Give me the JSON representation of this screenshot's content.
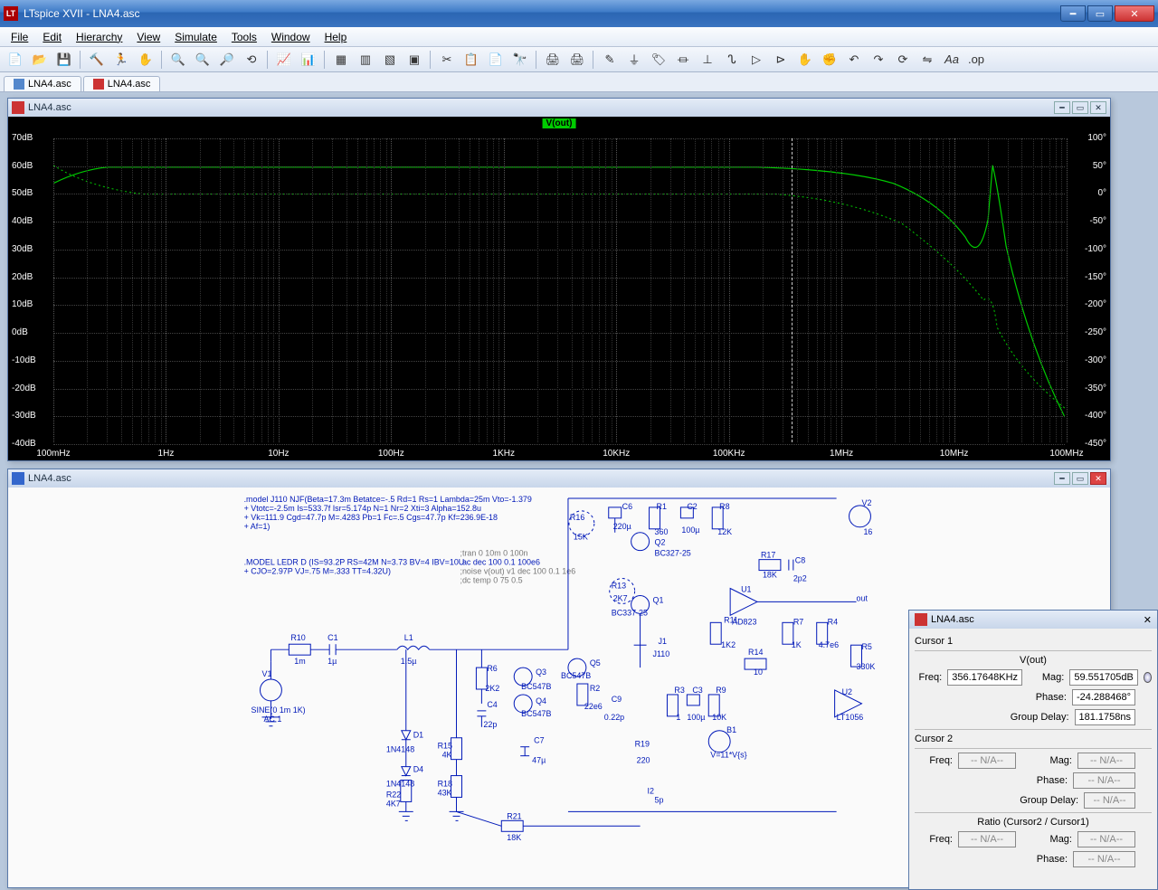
{
  "window": {
    "title": "LTspice XVII - LNA4.asc"
  },
  "menus": [
    "File",
    "Edit",
    "Hierarchy",
    "View",
    "Simulate",
    "Tools",
    "Window",
    "Help"
  ],
  "tabs": [
    {
      "icon": "sch",
      "label": "LNA4.asc"
    },
    {
      "icon": "plt",
      "label": "LNA4.asc"
    }
  ],
  "plot": {
    "title": "LNA4.asc",
    "trace_label": "V(out)",
    "y_left": [
      "70dB",
      "60dB",
      "50dB",
      "40dB",
      "30dB",
      "20dB",
      "10dB",
      "0dB",
      "-10dB",
      "-20dB",
      "-30dB",
      "-40dB"
    ],
    "y_right": [
      "100°",
      "50°",
      "0°",
      "-50°",
      "-100°",
      "-150°",
      "-200°",
      "-250°",
      "-300°",
      "-350°",
      "-400°",
      "-450°"
    ],
    "x": [
      "100mHz",
      "1Hz",
      "10Hz",
      "100Hz",
      "1KHz",
      "10KHz",
      "100KHz",
      "1MHz",
      "10MHz",
      "100MHz"
    ]
  },
  "schem": {
    "title": "LNA4.asc",
    "model1a": ".model J110 NJF(Beta=17.3m Betatce=-.5 Rd=1 Rs=1 Lambda=25m Vto=-1.379",
    "model1b": "+ Vtotc=-2.5m Is=533.7f Isr=5.174p N=1 Nr=2 Xti=3 Alpha=152.8u",
    "model1c": "+ Vk=111.9 Cgd=47.7p M=.4283 Pb=1 Fc=.5 Cgs=47.7p Kf=236.9E-18",
    "model1d": "+ Af=1)",
    "model2a": ".MODEL LEDR D (IS=93.2P RS=42M N=3.73 BV=4 IBV=10U",
    "model2b": "+ CJO=2.97P VJ=.75 M=.333 TT=4.32U)",
    "dir1": ";tran 0 10m 0 100n",
    "dir2": ".ac dec 100 0.1 100e6",
    "dir3": ";noise v(out) v1 dec 100 0.1 1e6",
    "dir4": ";dc temp 0 75 0.5",
    "v1name": "V1",
    "v1val1": "SINE(0 1m 1K)",
    "v1val2": "AC 1",
    "r10n": "R10",
    "r10v": "1m",
    "c1n": "C1",
    "c1v": "1µ",
    "l1n": "L1",
    "l1v": "1.5µ",
    "d1n": "D1",
    "d1v": "1N4148",
    "d4n": "D4",
    "d4v": "1N4148",
    "r22n": "R22",
    "r22v": "4K7",
    "r15n": "R15",
    "r15v": "4K",
    "r18n": "R18",
    "r18v": "43K",
    "r21n": "R21",
    "r21v": "18K",
    "r6n": "R6",
    "r6v": "2K2",
    "c4n": "C4",
    "c4v": "22p",
    "c7n": "C7",
    "c7v": "47µ",
    "q3n": "Q3",
    "q4n": "Q4",
    "q3v": "BC547B",
    "q4v": "BC547B",
    "r2n": "R2",
    "r2v": "22e6",
    "i2n": "I2",
    "i2v": "5p",
    "q5n": "Q5",
    "q5v": "BC547B",
    "c9n": "C9",
    "c9v": "0.22p",
    "r19n": "R19",
    "r19v": "220",
    "r16n": "R16",
    "r16v": "15K",
    "c6n": "C6",
    "c6v": "220µ",
    "r1n": "R1",
    "r1v": "360",
    "c2n": "C2",
    "c2v": "100µ",
    "r8n": "R8",
    "r8v": "12K",
    "q2n": "Q2",
    "q2v": "BC327-25",
    "r13n": "R13",
    "r13v": "2K7",
    "q1n": "Q1",
    "q1v": "BC337-25",
    "j1n": "J1",
    "j1v": "J110",
    "r3n": "R3",
    "r3v": "1",
    "c3n": "C3",
    "c3v": "100µ",
    "r9n": "R9",
    "r9v": "10K",
    "r11n": "R11",
    "r11v": "1K2",
    "r14n": "R14",
    "r14v": "10",
    "u1n": "U1",
    "u1v": "AD823",
    "r17n": "R17",
    "r17v": "18K",
    "c8n": "C8",
    "c8v": "2p2",
    "r7n": "R7",
    "r7v": "1K",
    "r4n": "R4",
    "r4v": "4.7e6",
    "r5n": "R5",
    "r5v": "330K",
    "b1n": "B1",
    "b1v": "V=11*V{s}",
    "u2n": "U2",
    "u2v": "LT1056",
    "v2n": "V2",
    "v2v": "16",
    "outlbl": "out"
  },
  "cursor": {
    "title": "LNA4.asc",
    "c1": "Cursor 1",
    "trace": "V(out)",
    "freq_k": "Freq:",
    "freq_v": "356.17648KHz",
    "mag_k": "Mag:",
    "mag_v": "59.551705dB",
    "phase_k": "Phase:",
    "phase_v": "-24.288468°",
    "gd_k": "Group Delay:",
    "gd_v": "181.1758ns",
    "c2": "Cursor 2",
    "na": "-- N/A--",
    "ratio": "Ratio (Cursor2 / Cursor1)"
  }
}
